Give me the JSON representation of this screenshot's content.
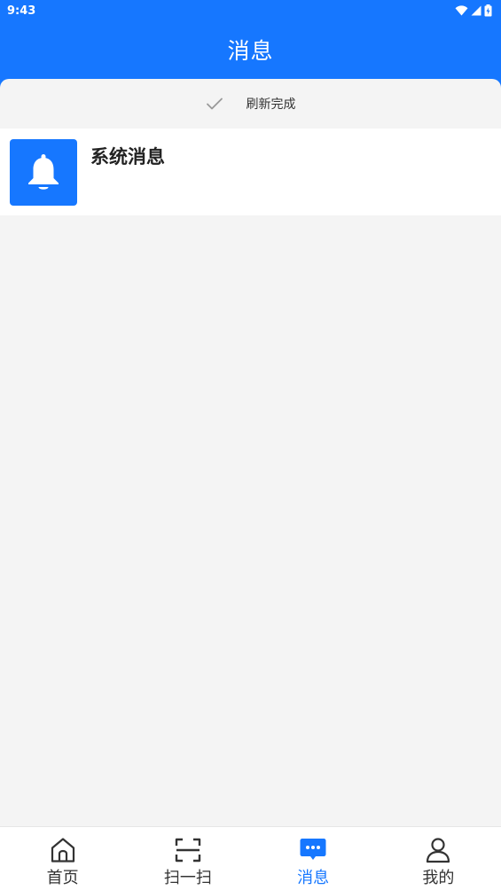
{
  "status_bar": {
    "time": "9:43"
  },
  "header": {
    "title": "消息"
  },
  "refresh": {
    "text": "刷新完成",
    "icon": "check-icon"
  },
  "messages": [
    {
      "title": "系统消息",
      "icon": "bell-icon"
    }
  ],
  "bottom_nav": [
    {
      "label": "首页",
      "icon": "home-icon",
      "active": false
    },
    {
      "label": "扫一扫",
      "icon": "scan-icon",
      "active": false
    },
    {
      "label": "消息",
      "icon": "message-icon",
      "active": true
    },
    {
      "label": "我的",
      "icon": "user-icon",
      "active": false
    }
  ],
  "colors": {
    "primary": "#1677ff",
    "background": "#f4f4f4",
    "text": "#333333"
  }
}
